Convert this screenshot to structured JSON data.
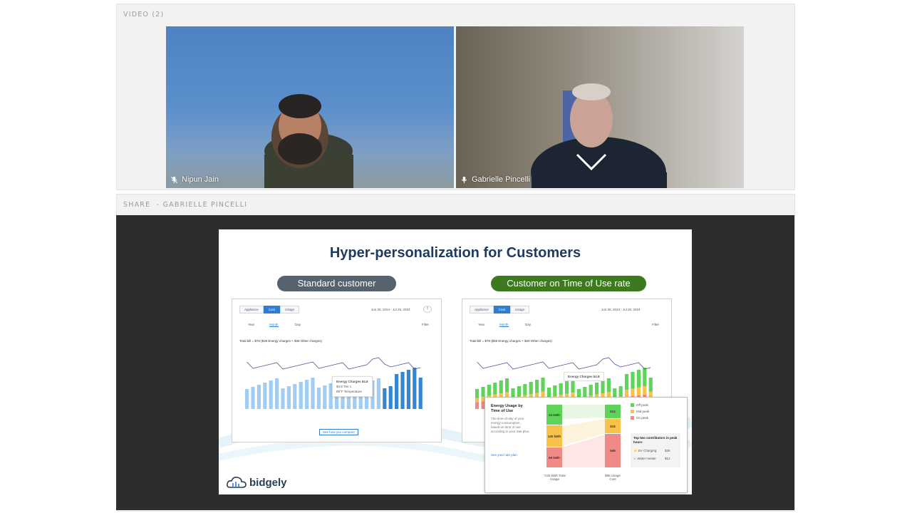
{
  "video_section": {
    "label": "VIDEO (2)",
    "participants": [
      {
        "name": "Nipun Jain",
        "mic": "muted"
      },
      {
        "name": "Gabrielle Pincelli",
        "mic": "on"
      }
    ]
  },
  "share_section": {
    "label": "SHARE  - GABRIELLE PINCELLI"
  },
  "slide": {
    "title": "Hyper-personalization for Customers",
    "left_pill": "Standard customer",
    "right_pill": "Customer on Time of Use rate",
    "brand": "bidgely",
    "left_app": {
      "tabs": [
        "Appliance",
        "Cost",
        "Usage"
      ],
      "subtabs": [
        "Year",
        "Month",
        "Day"
      ],
      "date_range": "Jun 26, 2024 - Jul 25, 2024",
      "filter": "Filter",
      "total": "Total bill = $78 ($36 Energy charges + $36 Other charges)",
      "tooltip_title": "Energy Charges $4.8",
      "tooltip_line1": "$4.8 Tier 1",
      "tooltip_line2": "89°F Temperature",
      "button": "See how you compare"
    },
    "right_app": {
      "tabs": [
        "Appliance",
        "Cost",
        "Usage"
      ],
      "subtabs": [
        "Year",
        "Month",
        "Day"
      ],
      "date_range": "Jun 26, 2024 - Jul 25, 2024",
      "filter": "Filter",
      "total": "Total bill = $78 ($56 Energy charges + $29 Other charges)",
      "tooltip_title": "Energy Charges $4.8"
    },
    "tou_card": {
      "title": "Energy Usage by Time of Use",
      "description": "The time-of-day of your energy consumption, based on time of use according to your rate plan.",
      "link": "See your rate plan",
      "blocks_left": [
        "24 kWh",
        "140 kWh",
        "69 kWh"
      ],
      "blocks_right": [
        "$14",
        "$15",
        "$46"
      ],
      "left_caption": "*234 kWh Total Usage",
      "right_caption": "$85 Usage Cost",
      "legend": [
        "Off peak",
        "Mid peak",
        "On peak"
      ],
      "legend_colors": [
        "#5fd35a",
        "#f7c14a",
        "#f08a86"
      ],
      "contributors_title": "Top two contributors in peak hours",
      "contributors": [
        {
          "label": "EV Charging",
          "value": "$26"
        },
        {
          "label": "Water Heater",
          "value": "$12"
        }
      ]
    }
  },
  "colors": {
    "left_pill": "#56636e",
    "right_pill": "#3d7a1f",
    "title": "#1f3a5f",
    "bar_light": "#9fcdf3",
    "bar_dark": "#3286d3",
    "line": "#5c4f9e"
  }
}
